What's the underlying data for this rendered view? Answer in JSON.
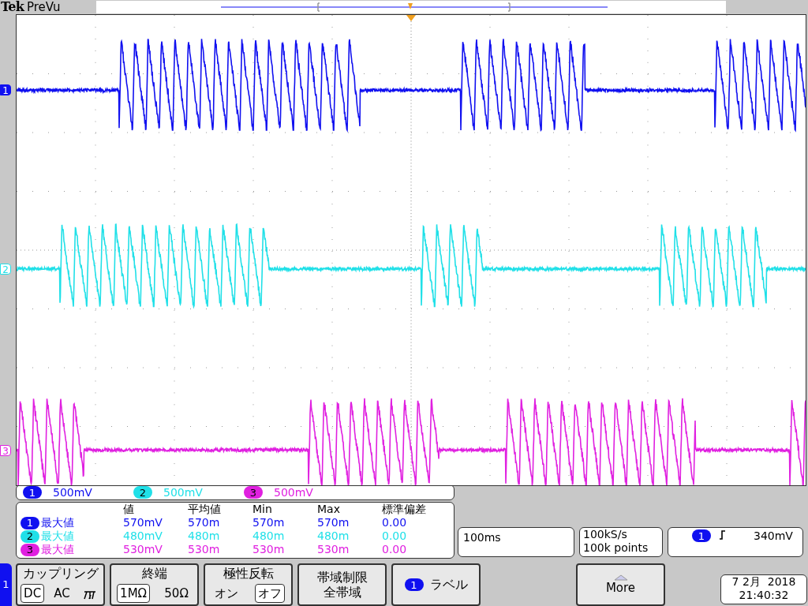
{
  "header": {
    "brand": "Tek",
    "mode": "PreVu"
  },
  "channels": [
    {
      "marker": "1",
      "color": "#1010f0",
      "scale_badge": "1",
      "scale": "500mV"
    },
    {
      "marker": "2",
      "color": "#20e0e8",
      "scale_badge": "2",
      "scale": "500mV"
    },
    {
      "marker": "3",
      "color": "#e020e0",
      "scale_badge": "3",
      "scale": "500mV"
    }
  ],
  "measurements": {
    "columns": [
      "値",
      "平均値",
      "Min",
      "Max",
      "標準偏差"
    ],
    "rows": [
      {
        "badge": "1",
        "name": "最大値",
        "values": [
          "570mV",
          "570m",
          "570m",
          "570m",
          "0.00"
        ]
      },
      {
        "badge": "2",
        "name": "最大値",
        "values": [
          "480mV",
          "480m",
          "480m",
          "480m",
          "0.00"
        ]
      },
      {
        "badge": "3",
        "name": "最大値",
        "values": [
          "530mV",
          "530m",
          "530m",
          "530m",
          "0.00"
        ]
      }
    ]
  },
  "timebase": {
    "scale": "100ms",
    "sample_rate": "100kS/s",
    "record_length": "100k points"
  },
  "trigger": {
    "badge": "1",
    "level": "340mV"
  },
  "menu": {
    "channel_tab": "1",
    "buttons": [
      {
        "kind": "options",
        "title": "カップリング",
        "options": [
          {
            "label": "DC",
            "selected": true
          },
          {
            "label": "AC",
            "selected": false
          },
          {
            "kind": "ground",
            "selected": false
          }
        ]
      },
      {
        "kind": "options",
        "title": "終端",
        "options": [
          {
            "label": "1MΩ",
            "selected": true
          },
          {
            "label": "50Ω",
            "selected": false
          }
        ]
      },
      {
        "kind": "options",
        "title": "極性反転",
        "options": [
          {
            "label": "オン",
            "selected": false
          },
          {
            "label": "オフ",
            "selected": true
          }
        ]
      },
      {
        "kind": "lines",
        "lines": [
          "帯域制限",
          "全帯域"
        ]
      },
      {
        "kind": "label",
        "badge": "1",
        "text": "ラベル"
      }
    ],
    "more": "More"
  },
  "date": {
    "date": "7 2月  2018",
    "time": "21:40:32"
  }
}
